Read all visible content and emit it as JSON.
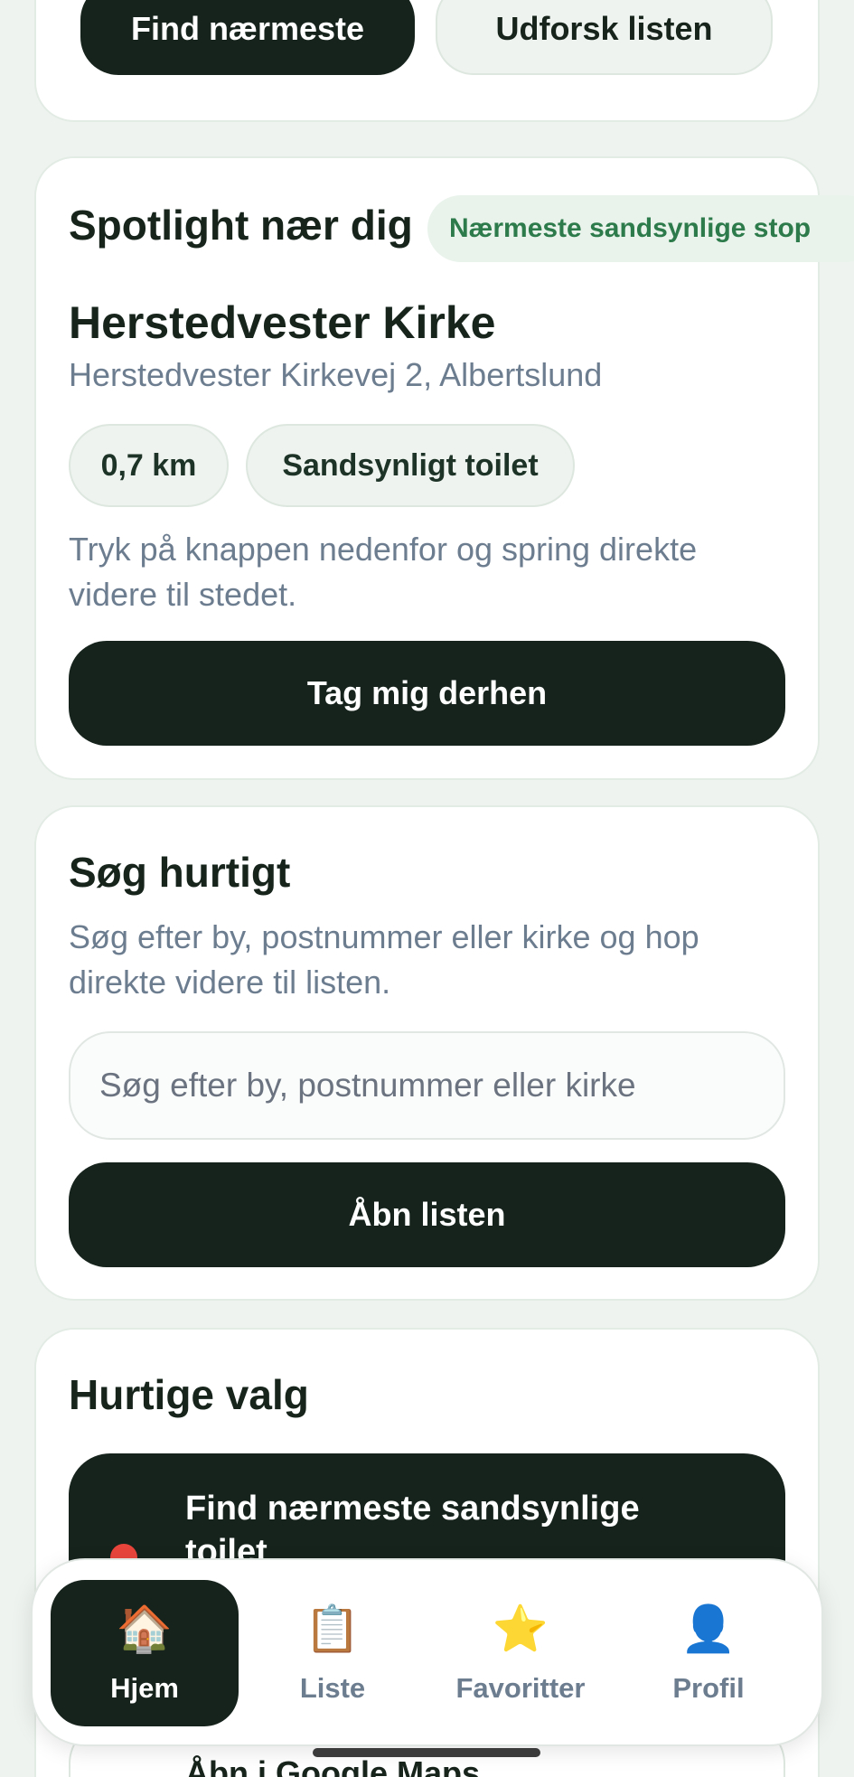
{
  "top_actions": {
    "find_nearest": "Find nærmeste",
    "explore_list": "Udforsk listen"
  },
  "spotlight": {
    "title": "Spotlight nær dig",
    "badge": "Nærmeste sandsynlige stop",
    "place_name": "Herstedvester Kirke",
    "address": "Herstedvester Kirkevej 2, Albertslund",
    "distance": "0,7 km",
    "toilet_tag": "Sandsynligt toilet",
    "description_line1": "Tryk på knappen nedenfor og spring direkte",
    "description_line2": "videre til stedet.",
    "cta": "Tag mig derhen"
  },
  "search": {
    "title": "Søg hurtigt",
    "description_line1": "Søg efter by, postnummer eller kirke og hop",
    "description_line2": "direkte videre til listen.",
    "placeholder": "Søg efter by, postnummer eller kirke",
    "open_list": "Åbn listen"
  },
  "quick": {
    "title": "Hurtige valg",
    "find_line1": "Find nærmeste sandsynlige",
    "find_line2": "toilet",
    "google_maps": "Åbn i Google Maps"
  },
  "nav": {
    "items": [
      {
        "label": "Hjem",
        "icon": "home-icon"
      },
      {
        "label": "Liste",
        "icon": "clipboard-icon"
      },
      {
        "label": "Favoritter",
        "icon": "star-icon"
      },
      {
        "label": "Profil",
        "icon": "profile-icon"
      }
    ]
  }
}
